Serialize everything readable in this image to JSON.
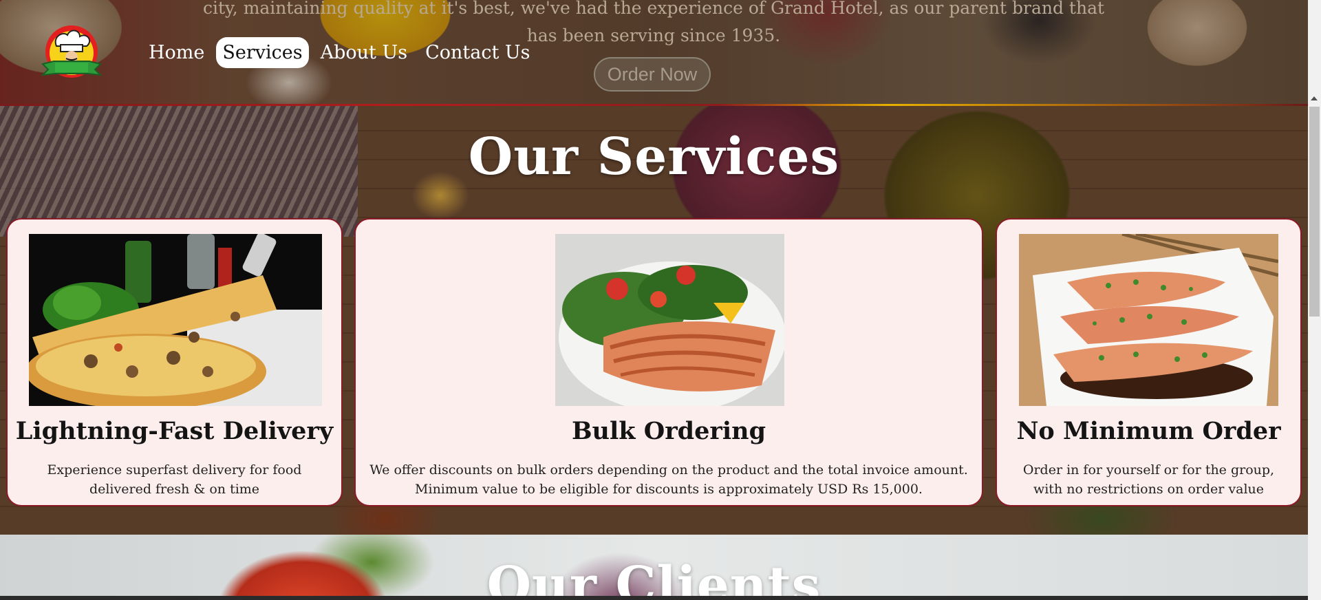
{
  "hero": {
    "text_line1": "city, maintaining quality at it's best, we've had the experience of Grand Hotel, as our parent brand that",
    "text_line2": "has been serving since 1935.",
    "order_button": "Order Now"
  },
  "nav": {
    "logo_icon": "chef-hat-logo-icon",
    "items": [
      {
        "label": "Home",
        "active": false
      },
      {
        "label": "Services",
        "active": true
      },
      {
        "label": "About Us",
        "active": false
      },
      {
        "label": "Contact Us",
        "active": false
      }
    ]
  },
  "services": {
    "title": "Our Services",
    "cards": [
      {
        "title": "Lightning-Fast Delivery",
        "text_line1": "Experience superfast delivery for food",
        "text_line2": "delivered fresh & on time",
        "image": "pizza-photo"
      },
      {
        "title": "Bulk Ordering",
        "text_line1": "We offer discounts on bulk orders depending on the product and the total invoice amount.",
        "text_line2": "Minimum value to be eligible for discounts is approximately USD Rs 15,000.",
        "image": "salmon-salad-photo"
      },
      {
        "title": "No Minimum Order",
        "text_line1": "Order in for yourself or for the group,",
        "text_line2": "with no restrictions on order value",
        "image": "grilled-salmon-photo"
      }
    ]
  },
  "clients": {
    "title": "Our Clients"
  },
  "colors": {
    "card_bg": "#fdeeee",
    "card_border": "#8b1a26",
    "nav_active_bg": "#ffffff",
    "accent_gold": "#e7b000"
  }
}
